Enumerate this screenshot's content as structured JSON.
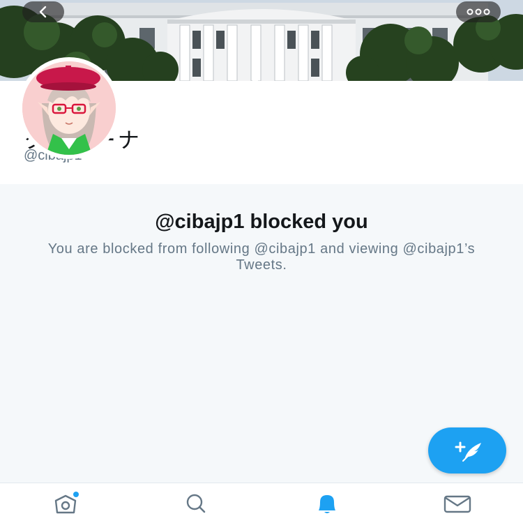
{
  "header": {
    "back_icon": "chevron-left-icon",
    "more_icon": "more-horizontal-icon"
  },
  "profile": {
    "display_name": "ククリーナ",
    "handle": "@cibajp1"
  },
  "blocked": {
    "title": "@cibajp1 blocked you",
    "description": "You are blocked from following @cibajp1 and viewing @cibajp1’s Tweets."
  },
  "compose": {
    "icon": "compose-tweet-icon",
    "color": "#1da1f2"
  },
  "bottom_nav": {
    "items": [
      {
        "icon": "home-icon",
        "active": false,
        "has_badge": true
      },
      {
        "icon": "search-icon",
        "active": false,
        "has_badge": false
      },
      {
        "icon": "notifications-icon",
        "active": true,
        "has_badge": false
      },
      {
        "icon": "messages-icon",
        "active": false,
        "has_badge": false
      }
    ]
  },
  "colors": {
    "accent": "#1da1f2",
    "text_primary": "#14171a",
    "text_secondary": "#657786",
    "panel_background": "#f5f8fa"
  }
}
